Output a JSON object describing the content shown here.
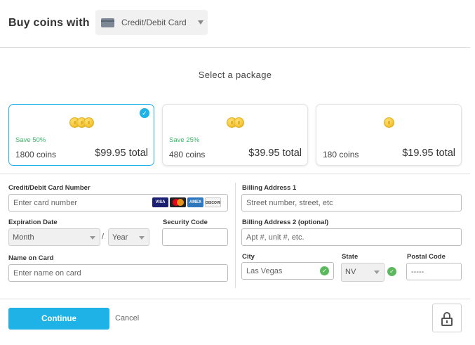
{
  "header": {
    "title": "Buy coins with",
    "payment_method": {
      "selected": "Credit/Debit Card",
      "icon": "credit-card-icon"
    }
  },
  "select_package_label": "Select a package",
  "packages": [
    {
      "save": "Save 50%",
      "coins": "1800 coins",
      "price": "$99.95 total",
      "coin_icon_count": 3,
      "selected": true
    },
    {
      "save": "Save 25%",
      "coins": "480 coins",
      "price": "$39.95 total",
      "coin_icon_count": 2,
      "selected": false
    },
    {
      "save": "",
      "coins": "180 coins",
      "price": "$19.95 total",
      "coin_icon_count": 1,
      "selected": false
    }
  ],
  "form": {
    "card_number": {
      "label": "Credit/Debit Card Number",
      "placeholder": "Enter card number"
    },
    "card_logos": [
      "VISA",
      "MC",
      "AMEX",
      "DISCOVER"
    ],
    "expiration": {
      "label": "Expiration Date",
      "month": "Month",
      "separator": "/",
      "year": "Year"
    },
    "security_code": {
      "label": "Security Code",
      "value": ""
    },
    "name_on_card": {
      "label": "Name on Card",
      "placeholder": "Enter name on card"
    },
    "billing1": {
      "label": "Billing Address 1",
      "placeholder": "Street number, street, etc"
    },
    "billing2": {
      "label": "Billing Address 2 (optional)",
      "placeholder": "Apt #, unit #, etc."
    },
    "city": {
      "label": "City",
      "value": "Las Vegas",
      "valid": true
    },
    "state": {
      "label": "State",
      "value": "NV",
      "valid": true
    },
    "postal_code": {
      "label": "Postal Code",
      "placeholder": "-----"
    }
  },
  "footer": {
    "continue_label": "Continue",
    "cancel_label": "Cancel"
  },
  "colors": {
    "accent": "#1fb2e6",
    "save_green": "#3cb869",
    "valid_green": "#5cb85c"
  }
}
